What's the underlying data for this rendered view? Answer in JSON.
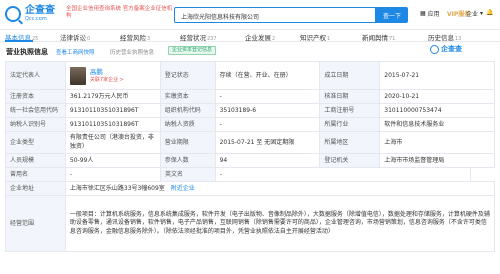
{
  "header": {
    "logo_cn": "企查查",
    "logo_en": "Qcc.com",
    "tagline": "全国企业信用查询系统 官方备案企业征信机构",
    "search_value": "上海欣光阳信息科技有限公司",
    "search_button": "查一下",
    "nav": [
      "应用",
      "VIP服务",
      "企业",
      "通知"
    ]
  },
  "tabs": [
    {
      "label": "基本信息",
      "count": "25"
    },
    {
      "label": "法律诉讼",
      "count": "0"
    },
    {
      "label": "经营风险",
      "count": "3"
    },
    {
      "label": "经营状况",
      "count": "237"
    },
    {
      "label": "企业发展",
      "count": "2"
    },
    {
      "label": "知识产权",
      "count": "1"
    },
    {
      "label": "新闻舆情",
      "count": "71"
    },
    {
      "label": "历史信息",
      "count": "13"
    }
  ],
  "section": {
    "title": "营业执照信息",
    "link_report": "查看工商网快照",
    "link_license": "历史营业执照信息",
    "green_tag": "企业资本登记信息",
    "brand": "企查查"
  },
  "table": {
    "owner_label": "法定代表人",
    "owner_name": "高鹏",
    "owner_sub": "关联7家企业 >",
    "status_label": "登记状态",
    "status_value": "存续（在营、开业、在册）",
    "found_label": "成立日期",
    "found_value": "2015-07-21",
    "capital_label": "注册资本",
    "capital_value": "361.2179万元人民币",
    "paid_label": "实缴资本",
    "paid_value": "-",
    "approve_label": "核准日期",
    "approve_value": "2020-10-21",
    "credit_label": "统一社会信用代码",
    "credit_value": "91310110351031896T",
    "org_label": "组织机构代码",
    "org_value": "35103189-6",
    "reg_label": "工商注册号",
    "reg_value": "310110000753474",
    "tax_label": "纳税人识别号",
    "tax_value": "91310110351031896T",
    "taxq_label": "纳税人资质",
    "taxq_value": "-",
    "industry_label": "所属行业",
    "industry_value": "软件和信息技术服务业",
    "type_label": "企业类型",
    "type_value": "有限责任公司（港澳台投资，非独资）",
    "term_label": "营业期限",
    "term_value": "2015-07-21 至 无固定期限",
    "area_label": "所属地区",
    "area_value": "上海市",
    "staff_label": "人员规模",
    "staff_value": "50-99人",
    "insured_label": "参保人数",
    "insured_value": "94",
    "authority_label": "登记机关",
    "authority_value": "上海市市场监督管理局",
    "former_label": "曾用名",
    "former_value": "-",
    "en_label": "英文名",
    "en_value": "-",
    "addr_label": "企业地址",
    "addr_value": "上海市徐汇区乐山路33号3幢609室",
    "addr_link": "附近企业",
    "scope_label": "经营范围",
    "scope_value": "一般项目：计算机系统服务，信息系统集成服务，软件开发（电子出版物、音像制品除外），大数据服务（除增值电信），数据处理和存储服务，计算机硬件及辅助设备零售，通讯设备销售，软件销售，电子产品销售，互联网销售（除销售需要许可的商品），企业管理咨询，市场营销策划，信息咨询服务（不含许可类信息咨询服务，金融信息服务除外）。（除依法须经批准的项目外，凭营业执照依法自主开展经营活动）"
  }
}
